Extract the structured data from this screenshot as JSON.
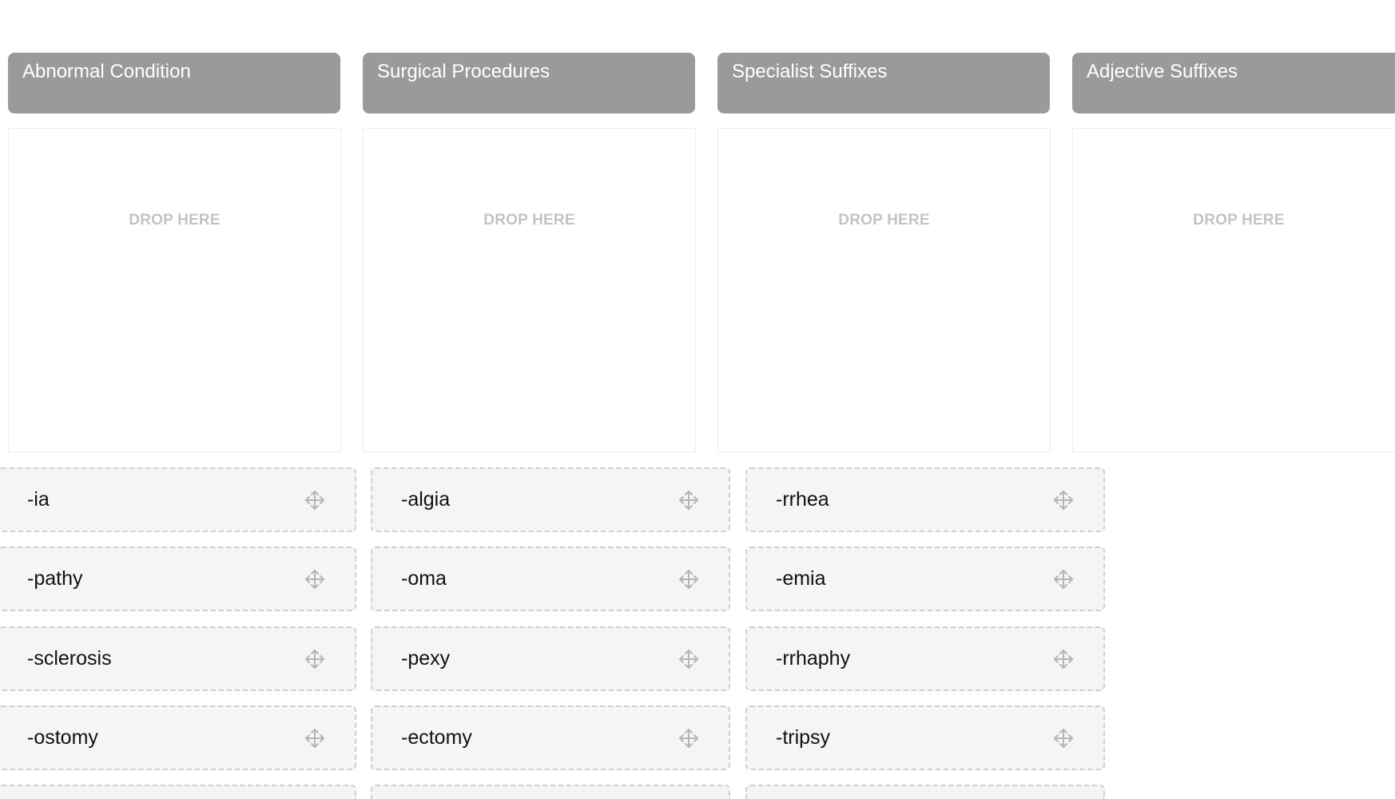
{
  "categories": [
    {
      "title": "Abnormal Condition",
      "drop_label": "DROP HERE"
    },
    {
      "title": "Surgical Procedures",
      "drop_label": "DROP HERE"
    },
    {
      "title": "Specialist Suffixes",
      "drop_label": "DROP HERE"
    },
    {
      "title": "Adjective Suffixes",
      "drop_label": "DROP HERE"
    }
  ],
  "terms": [
    [
      "-ia",
      "-algia",
      "-rrhea"
    ],
    [
      "-pathy",
      "-oma",
      "-emia"
    ],
    [
      "-sclerosis",
      "-pexy",
      "-rrhaphy"
    ],
    [
      "-ostomy",
      "-ectomy",
      "-tripsy"
    ],
    [
      "",
      "",
      ""
    ]
  ],
  "icons": {
    "drag_handle": "move-icon",
    "drag_handle_color": "#b5b5b5"
  },
  "colors": {
    "header_bg": "#9a9a9a",
    "card_bg": "#f5f5f5",
    "card_border": "#cfcfcf",
    "drop_label": "#c3c3c3"
  }
}
